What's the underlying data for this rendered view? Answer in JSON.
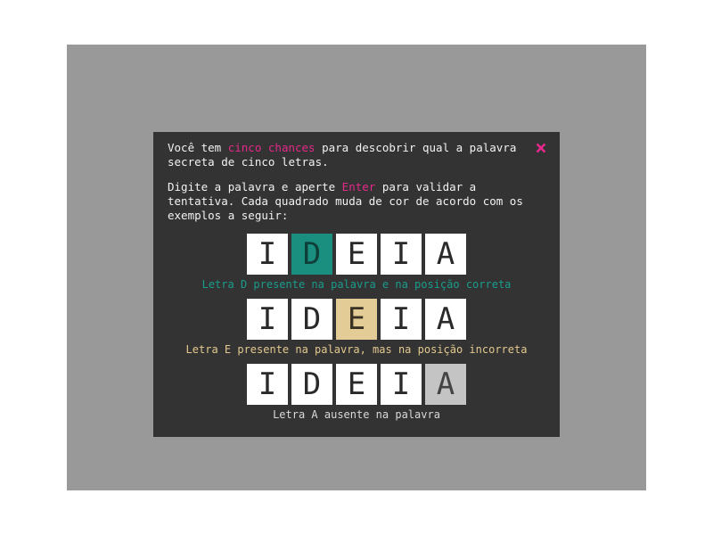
{
  "dialog": {
    "close_icon": "×",
    "intro": {
      "before": "Você tem ",
      "highlight": "cinco chances",
      "after": " para descobrir qual a palavra secreta de cinco letras."
    },
    "instructions": {
      "before": "Digite a palavra e aperte ",
      "highlight": "Enter",
      "after": " para validar a tentativa. Cada quadrado muda de cor de acordo com os exemplos a seguir:"
    },
    "examples": [
      {
        "letters": [
          "I",
          "D",
          "E",
          "I",
          "A"
        ],
        "caption": "Letra D presente na palavra e na posição correta"
      },
      {
        "letters": [
          "I",
          "D",
          "E",
          "I",
          "A"
        ],
        "caption": "Letra E presente na palavra, mas na posição incorreta"
      },
      {
        "letters": [
          "I",
          "D",
          "E",
          "I",
          "A"
        ],
        "caption": "Letra A ausente na palavra"
      }
    ]
  },
  "colors": {
    "highlight": "#e6288a",
    "correct": "#1a8f80",
    "present": "#e3cc95",
    "absent": "#c4c4c4"
  }
}
